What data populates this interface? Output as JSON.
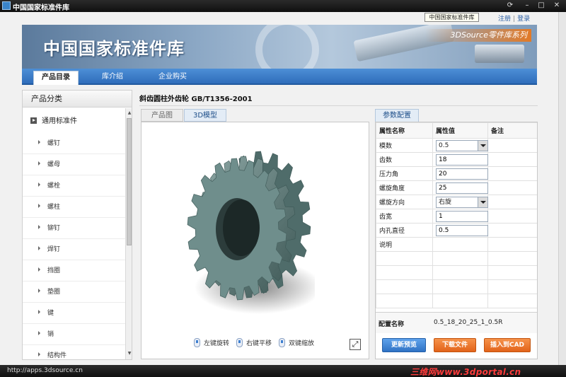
{
  "window": {
    "title": "中国国家标准件库",
    "buttons": {
      "refresh": "⟳",
      "minimize": "–",
      "maximize": "□",
      "close": "✕"
    }
  },
  "tooltip": "中国国家标准件库",
  "top_links": {
    "register": "注册",
    "login": "登录",
    "separator": "|"
  },
  "banner": {
    "title": "中国国家标准件库",
    "series": "3DSource零件库系列"
  },
  "nav": {
    "tabs": [
      "产品目录",
      "库介绍",
      "企业购买"
    ],
    "active_index": 0
  },
  "sidebar": {
    "header": "产品分类",
    "category": "通用标准件",
    "items": [
      "螺钉",
      "螺母",
      "螺栓",
      "螺柱",
      "铆钉",
      "焊钉",
      "挡圈",
      "垫圈",
      "键",
      "销",
      "结构件"
    ]
  },
  "product": {
    "title": "斜齿圆柱外齿轮  GB/T1356-2001"
  },
  "viewer": {
    "tabs": [
      "产品图",
      "3D模型"
    ],
    "active_tab": "3D模型",
    "hints": [
      "左键旋转",
      "右键平移",
      "双键缩放"
    ],
    "fullscreen_icon": "fullscreen-icon"
  },
  "params": {
    "tab": "参数配置",
    "headers": [
      "属性名称",
      "属性值",
      "备注"
    ],
    "rows": [
      {
        "name": "模数",
        "value": "0.5",
        "type": "select"
      },
      {
        "name": "齿数",
        "value": "18",
        "type": "input"
      },
      {
        "name": "压力角",
        "value": "20",
        "type": "input"
      },
      {
        "name": "螺旋角度",
        "value": "25",
        "type": "input"
      },
      {
        "name": "螺旋方向",
        "value": "右旋",
        "type": "select"
      },
      {
        "name": "齿宽",
        "value": "1",
        "type": "input"
      },
      {
        "name": "内孔直径",
        "value": "0.5",
        "type": "input"
      },
      {
        "name": "说明",
        "value": "",
        "type": "text"
      }
    ],
    "config_label": "配置名称",
    "config_value": "0.5_18_20_25_1_0.5R",
    "buttons": {
      "refresh": "更新预览",
      "download": "下载文件",
      "insert": "插入到CAD"
    }
  },
  "status": {
    "url": "http://apps.3dsource.cn",
    "watermark": "三维网www.3dportal.cn"
  },
  "colors": {
    "accent": "#2f6dbb",
    "orange": "#e2631a",
    "gear": "#5f807e"
  }
}
